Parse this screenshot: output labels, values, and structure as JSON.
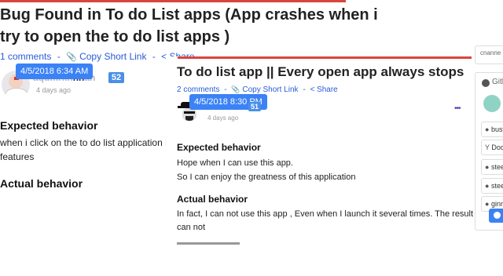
{
  "back_post": {
    "title_line1": "Bug Found in To do List apps (App crashes when i",
    "title_line2": "try to open the to do list apps )",
    "comments": "1 comments",
    "copy_short_link": "Copy Short Link",
    "share": "Share",
    "tooltip": "4/5/2018 6:34 AM",
    "author_visible": "hn",
    "reputation": "52",
    "time_ago": "4 days ago",
    "expected_heading": "Expected behavior",
    "expected_line1": "when i click on the to do list application ico",
    "expected_line2": "features",
    "actual_heading": "Actual behavior"
  },
  "front_post": {
    "title": "To do list app || Every open app always stops",
    "comments": "2 comments",
    "copy_short_link": "Copy Short Link",
    "share": "Share",
    "tooltip": "4/5/2018 8:30 PM",
    "reputation": "51",
    "time_ago": "4 days ago",
    "more": "•••",
    "expected_heading": "Expected behavior",
    "expected_line1": "Hope when I can use this app.",
    "expected_line2": "So I can enjoy the greatness of this application",
    "actual_heading": "Actual behavior",
    "actual_line1": "In fact, I can not use this app , Even when I launch it several times. The result also",
    "actual_line2": "can not"
  },
  "sidebar": {
    "top_text": "cnanne",
    "github_label": "Gith",
    "tags": [
      "busy-v",
      "Docu",
      "steem",
      "steem",
      "ginm"
    ]
  },
  "separators": {
    "dash": "-"
  },
  "colors": {
    "accent_red": "#d9453d",
    "link_blue": "#2a5bd7",
    "tooltip_blue": "#3b82f6",
    "badge_blue": "#4a8fe7"
  }
}
